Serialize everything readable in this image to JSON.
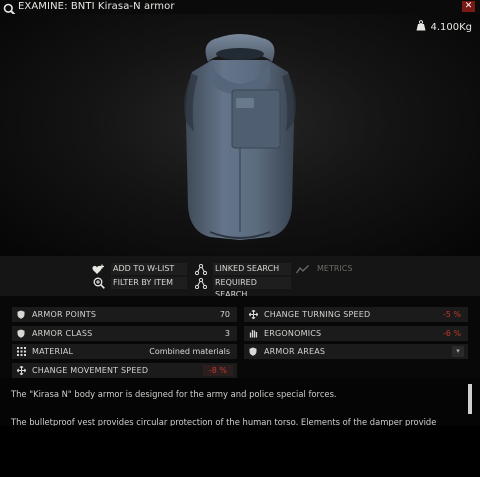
{
  "window": {
    "title": "EXAMINE: BNTI Kirasa-N armor",
    "close_label": "✕",
    "weight": "4.100Kg"
  },
  "actions": {
    "add_to_wlist": "ADD TO W-LIST",
    "linked_search": "LINKED SEARCH",
    "metrics": "METRICS",
    "filter_by_item": "FILTER BY ITEM",
    "required_search": "REQUIRED SEARCH"
  },
  "stats": {
    "armor_points": {
      "label": "ARMOR POINTS",
      "value": "70"
    },
    "armor_class": {
      "label": "ARMOR CLASS",
      "value": "3"
    },
    "material": {
      "label": "MATERIAL",
      "value": "Combined materials"
    },
    "change_movement_speed": {
      "label": "CHANGE MOVEMENT SPEED",
      "value": "-8 %"
    },
    "change_turning_speed": {
      "label": "CHANGE TURNING SPEED",
      "value": "-5 %"
    },
    "ergonomics": {
      "label": "ERGONOMICS",
      "value": "-6 %"
    },
    "armor_areas": {
      "label": "ARMOR AREAS"
    }
  },
  "description": {
    "line1": "The \"Kirasa N\" body armor is designed for the army and police special forces.",
    "line2": "The bulletproof vest provides circular protection of the human torso. Elements of the damper provide"
  },
  "colors": {
    "negative": "#c0382b",
    "close_bg": "#7a1a14",
    "vest": "#5b6b7c"
  },
  "icons": {
    "search": "magnifier-icon",
    "weight": "weight-icon",
    "wishlist": "heart-plus-icon",
    "linked": "network-icon",
    "metrics": "chart-line-icon",
    "filter": "magnifier-plus-icon",
    "required": "network-icon"
  }
}
